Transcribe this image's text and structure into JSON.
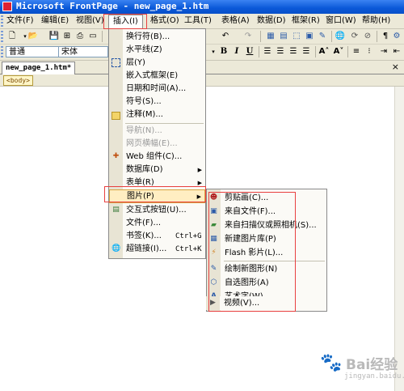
{
  "window": {
    "title": "Microsoft FrontPage - new_page_1.htm"
  },
  "menubar": [
    {
      "label": "文件(F)"
    },
    {
      "label": "编辑(E)"
    },
    {
      "label": "视图(V)"
    },
    {
      "label": "插入(I)",
      "active": true
    },
    {
      "label": "格式(O)"
    },
    {
      "label": "工具(T)"
    },
    {
      "label": "表格(A)"
    },
    {
      "label": "数据(D)"
    },
    {
      "label": "框架(R)"
    },
    {
      "label": "窗口(W)"
    },
    {
      "label": "帮助(H)"
    }
  ],
  "format_toolbar": {
    "style_value": "普通",
    "font_value": "宋体",
    "bold": "B",
    "italic": "I",
    "underline": "U"
  },
  "document": {
    "tab": "new_page_1.htm*",
    "close": "×",
    "tag": "<body>"
  },
  "insert_menu": [
    {
      "label": "换行符(B)...",
      "icon": "",
      "enabled": true
    },
    {
      "label": "水平线(Z)",
      "icon": "",
      "enabled": true
    },
    {
      "label": "层(Y)",
      "icon": "layer-icon",
      "enabled": true
    },
    {
      "label": "嵌入式框架(E)",
      "icon": "",
      "enabled": true
    },
    {
      "label": "日期和时间(A)...",
      "icon": "",
      "enabled": true
    },
    {
      "label": "符号(S)...",
      "icon": "",
      "enabled": true
    },
    {
      "label": "注释(M)...",
      "icon": "comment-icon",
      "enabled": true
    },
    {
      "label": "导航(N)...",
      "icon": "",
      "enabled": false
    },
    {
      "label": "网页横幅(E)...",
      "icon": "",
      "enabled": false
    },
    {
      "label": "Web 组件(C)...",
      "icon": "web-component-icon",
      "enabled": true
    },
    {
      "label": "数据库(D)",
      "icon": "",
      "enabled": true,
      "submenu": true
    },
    {
      "label": "表单(R)",
      "icon": "",
      "enabled": true,
      "submenu": true
    },
    {
      "label": "图片(P)",
      "icon": "",
      "enabled": true,
      "submenu": true,
      "highlighted": true
    },
    {
      "label": "交互式按钮(U)...",
      "icon": "interactive-button-icon",
      "enabled": true
    },
    {
      "label": "文件(F)...",
      "icon": "",
      "enabled": true
    },
    {
      "label": "书签(K)...",
      "shortcut": "Ctrl+G",
      "icon": "",
      "enabled": true
    },
    {
      "label": "超链接(I)...",
      "shortcut": "Ctrl+K",
      "icon": "hyperlink-icon",
      "enabled": true
    }
  ],
  "picture_submenu": [
    {
      "label": "剪贴画(C)...",
      "icon": "clipart-icon"
    },
    {
      "label": "来自文件(F)...",
      "icon": "from-file-icon"
    },
    {
      "label": "来自扫描仪或照相机(S)...",
      "icon": "scanner-icon"
    },
    {
      "label": "新建图片库(P)",
      "icon": "photo-gallery-icon"
    },
    {
      "label": "Flash 影片(L)...",
      "icon": "flash-icon"
    },
    {
      "label": "绘制新图形(N)",
      "icon": "new-drawing-icon"
    },
    {
      "label": "自选图形(A)",
      "icon": "autoshapes-icon"
    },
    {
      "label": "艺术字(W)...",
      "icon": "wordart-icon"
    },
    {
      "label": "视频(V)...",
      "icon": "video-icon"
    }
  ],
  "watermark": {
    "text": "Bai经验",
    "url": "jingyan.baidu.com"
  }
}
